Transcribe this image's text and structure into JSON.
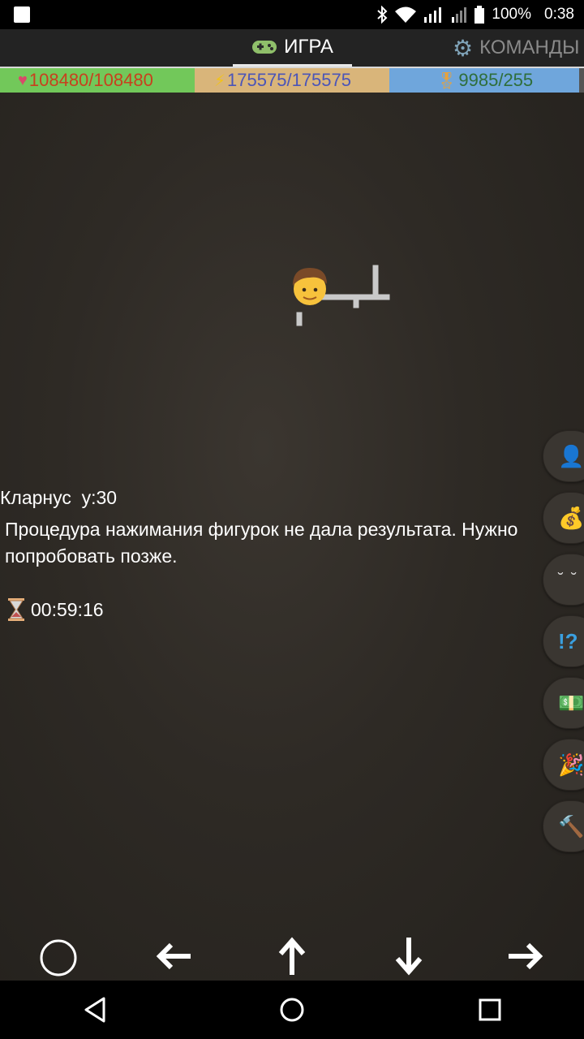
{
  "status_bar": {
    "battery": "100%",
    "time": "0:38"
  },
  "tabs": [
    {
      "label": "ИГРА",
      "icon": "gamepad-icon",
      "active": true
    },
    {
      "label": "КОМАНДЫ",
      "icon": "gear-icon",
      "active": false
    }
  ],
  "stats": {
    "health": {
      "icon": "heart-icon",
      "value": "108480/108480",
      "color": "#c8401e",
      "bg": "#72c85a"
    },
    "energy": {
      "icon": "lightning-icon",
      "value": "175575/175575",
      "color": "#4b55b8",
      "bg": "#d9b57a"
    },
    "experience": {
      "icon": "medal-icon",
      "value": "9985/255",
      "color": "#2f6e3a",
      "bg": "#6fa6dc"
    }
  },
  "game": {
    "player_line": "Кларнус  y:30",
    "message": "Процедура нажимания фигурок не дала результата. Нужно попробовать позже.",
    "timer": "00:59:16"
  },
  "side_buttons": [
    {
      "name": "profile",
      "icon": "person-icon",
      "glyph": "👤"
    },
    {
      "name": "money",
      "icon": "money-bag-icon",
      "glyph": "💰"
    },
    {
      "name": "eyes",
      "icon": "eyes-icon",
      "glyph": "‥"
    },
    {
      "name": "quests",
      "icon": "question-exclamation-icon",
      "glyph": "⁉"
    },
    {
      "name": "cash",
      "icon": "banknote-icon",
      "glyph": "💵"
    },
    {
      "name": "party",
      "icon": "party-popper-icon",
      "glyph": "🎉"
    },
    {
      "name": "craft",
      "icon": "hammer-icon",
      "glyph": "🔨"
    }
  ],
  "nav": [
    "circle-icon",
    "arrow-left-icon",
    "arrow-up-icon",
    "arrow-down-icon",
    "arrow-right-icon"
  ]
}
